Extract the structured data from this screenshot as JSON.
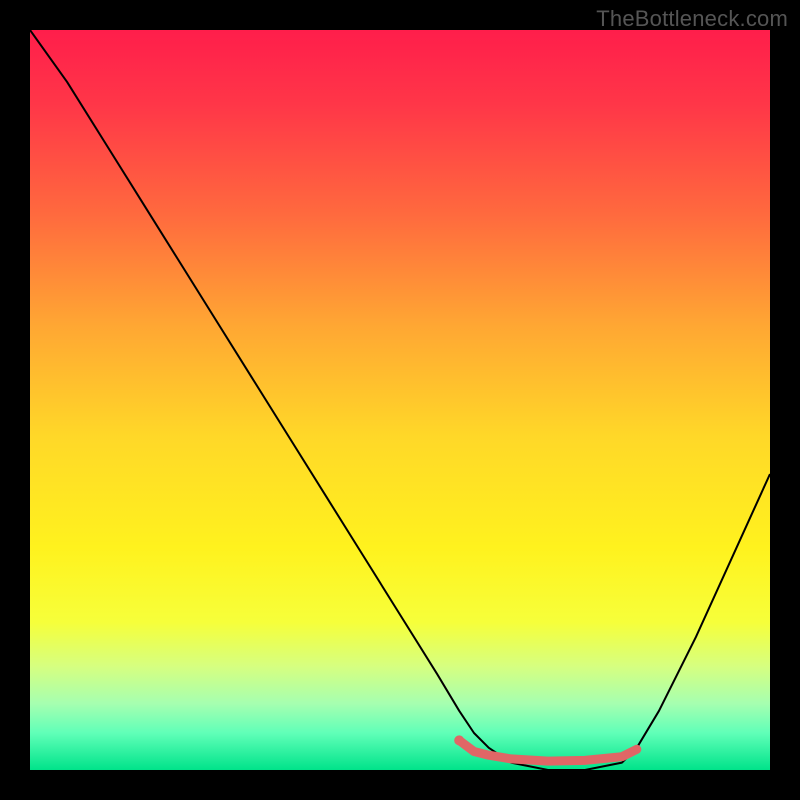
{
  "watermark": "TheBottleneck.com",
  "chart_data": {
    "type": "line",
    "title": "",
    "xlabel": "",
    "ylabel": "",
    "xlim": [
      0,
      100
    ],
    "ylim": [
      0,
      100
    ],
    "background_gradient": {
      "direction": "vertical",
      "stops": [
        {
          "pos": 0.0,
          "color": "#ff1e4b"
        },
        {
          "pos": 0.1,
          "color": "#ff3648"
        },
        {
          "pos": 0.25,
          "color": "#ff6a3e"
        },
        {
          "pos": 0.4,
          "color": "#ffa733"
        },
        {
          "pos": 0.55,
          "color": "#ffd828"
        },
        {
          "pos": 0.7,
          "color": "#fff21e"
        },
        {
          "pos": 0.8,
          "color": "#f6ff3a"
        },
        {
          "pos": 0.86,
          "color": "#d6ff80"
        },
        {
          "pos": 0.91,
          "color": "#a6ffb0"
        },
        {
          "pos": 0.95,
          "color": "#60ffb8"
        },
        {
          "pos": 1.0,
          "color": "#00e38a"
        }
      ]
    },
    "series": [
      {
        "name": "bottleneck-curve",
        "stroke": "#000000",
        "stroke_width": 2,
        "x": [
          0,
          5,
          10,
          15,
          20,
          25,
          30,
          35,
          40,
          45,
          50,
          55,
          58,
          60,
          62,
          65,
          70,
          75,
          80,
          82,
          85,
          90,
          95,
          100
        ],
        "y": [
          100,
          93,
          85,
          77,
          69,
          61,
          53,
          45,
          37,
          29,
          21,
          13,
          8,
          5,
          3,
          1,
          0,
          0,
          1,
          3,
          8,
          18,
          29,
          40
        ]
      },
      {
        "name": "highlight-band",
        "stroke": "#e06666",
        "stroke_width": 9,
        "linecap": "round",
        "x": [
          58,
          60,
          62,
          65,
          70,
          75,
          80,
          82
        ],
        "y": [
          4.0,
          2.5,
          2.0,
          1.5,
          1.2,
          1.3,
          1.8,
          2.8
        ]
      }
    ],
    "markers": [
      {
        "name": "dot",
        "x": 58,
        "y": 4.0,
        "r": 5,
        "fill": "#e06666"
      }
    ]
  }
}
